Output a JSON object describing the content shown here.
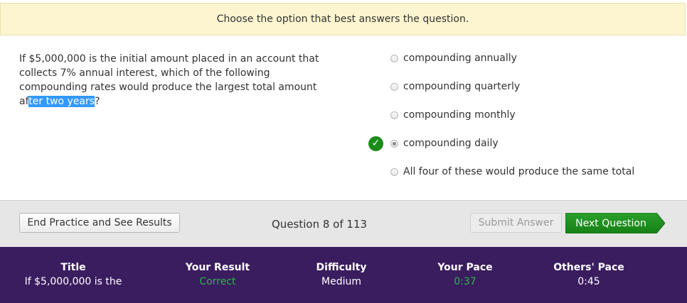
{
  "banner": {
    "instruction": "Choose the option that best answers the question."
  },
  "question": {
    "text_before": "If $5,000,000 is the initial amount placed in an account that collects 7% annual interest, which of the following compounding rates would produce the largest total amount af",
    "text_highlighted": "ter two years",
    "text_after": "?"
  },
  "options": [
    {
      "label": "compounding annually",
      "selected": false,
      "correct_mark": false
    },
    {
      "label": "compounding quarterly",
      "selected": false,
      "correct_mark": false
    },
    {
      "label": "compounding monthly",
      "selected": false,
      "correct_mark": false
    },
    {
      "label": "compounding daily",
      "selected": true,
      "correct_mark": true
    },
    {
      "label": "All four of these would produce the same total",
      "selected": false,
      "correct_mark": false
    }
  ],
  "controls": {
    "end_button": "End Practice and See Results",
    "question_counter": "Question 8 of 113",
    "submit_button": "Submit Answer",
    "next_button": "Next Question"
  },
  "stats": [
    {
      "heading": "Title",
      "value": "If $5,000,000 is the",
      "value_color": "#ffffff"
    },
    {
      "heading": "Your Result",
      "value": "Correct",
      "value_color": "#2fb34a"
    },
    {
      "heading": "Difficulty",
      "value": "Medium",
      "value_color": "#ffffff"
    },
    {
      "heading": "Your Pace",
      "value": "0:37",
      "value_color": "#2fb34a"
    },
    {
      "heading": "Others' Pace",
      "value": "0:45",
      "value_color": "#ffffff"
    }
  ],
  "colors": {
    "banner_bg": "#fcf5cf",
    "highlight": "#3399ff",
    "next_button": "#1b8c1b",
    "stats_bg": "#3a1d5f",
    "accent_green": "#2fb34a"
  },
  "icons": {
    "correct": "checkmark-circle-icon"
  }
}
